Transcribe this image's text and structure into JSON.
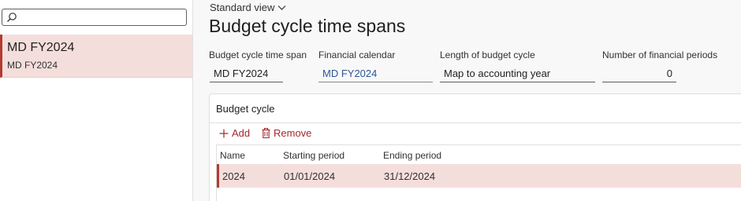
{
  "left_pane": {
    "search": {
      "placeholder": ""
    },
    "items": [
      {
        "title": "MD FY2024",
        "subtitle": "MD FY2024"
      }
    ]
  },
  "header": {
    "view_name": "Standard view",
    "page_title": "Budget cycle time spans"
  },
  "fields": {
    "time_span": {
      "label": "Budget cycle time span",
      "value": "MD FY2024"
    },
    "financial_calendar": {
      "label": "Financial calendar",
      "value": "MD FY2024"
    },
    "length": {
      "label": "Length of budget cycle",
      "value": "Map to accounting year"
    },
    "num_periods": {
      "label": "Number of financial periods",
      "value": "0"
    }
  },
  "budget_cycle": {
    "title": "Budget cycle",
    "add_label": "Add",
    "remove_label": "Remove",
    "columns": [
      "Name",
      "Starting period",
      "Ending period"
    ],
    "rows": [
      {
        "name": "2024",
        "start": "01/01/2024",
        "end": "31/12/2024"
      }
    ]
  },
  "colors": {
    "accent": "#b33b2e",
    "selection": "#f4dedc",
    "link": "#2b5797"
  }
}
